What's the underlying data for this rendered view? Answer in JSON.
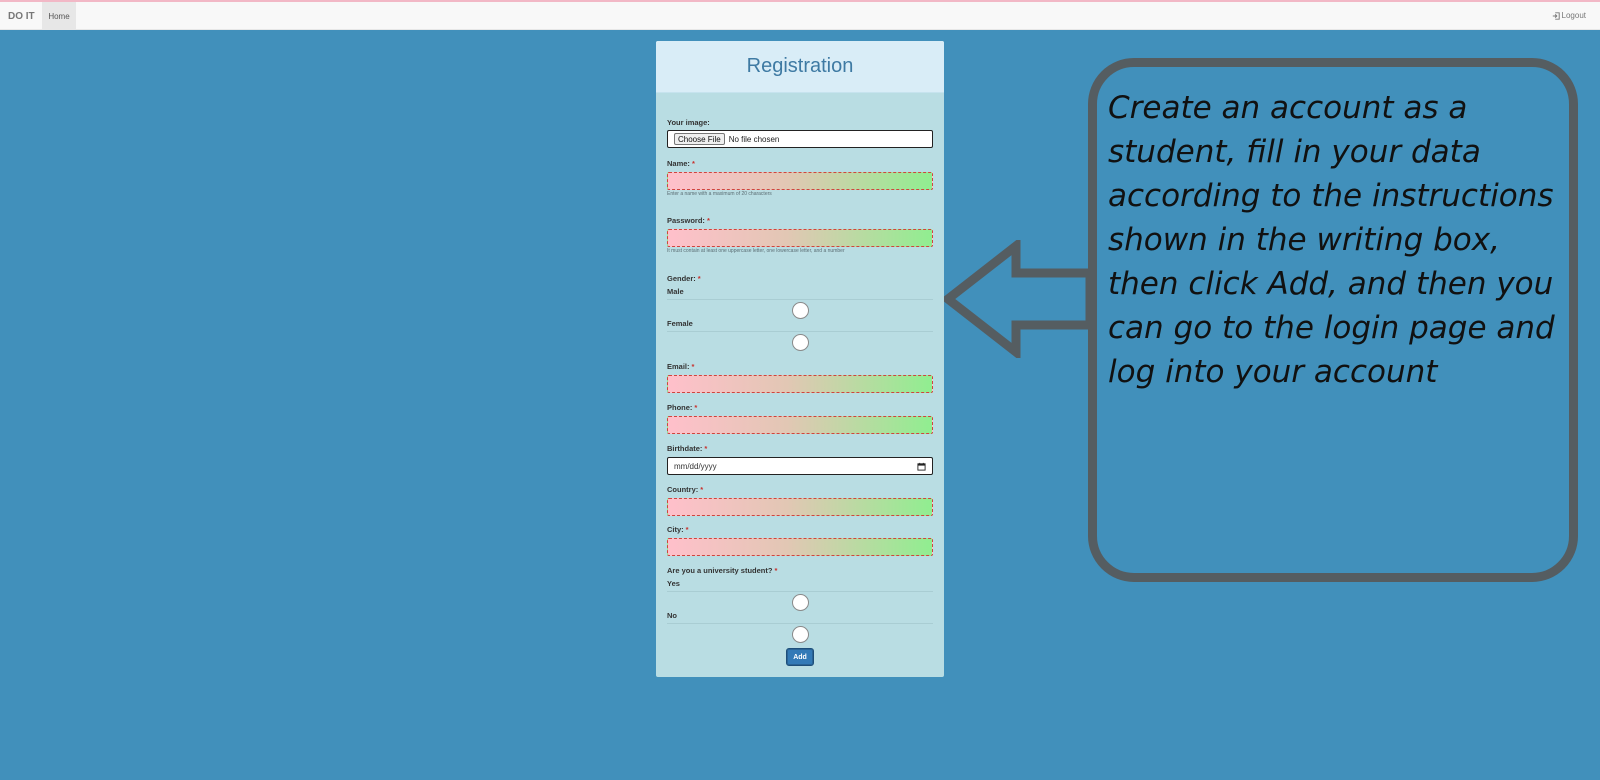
{
  "navbar": {
    "brand": "DO IT",
    "home": "Home",
    "logout": "Logout"
  },
  "panel": {
    "title": "Registration"
  },
  "form": {
    "image_label": "Your image:",
    "file_button": "Choose File",
    "file_status": "No file chosen",
    "name_label": "Name:",
    "name_hint": "Enter a name with a maximum of 20 characters",
    "password_label": "Password:",
    "password_hint": "It must contain at least one uppercase letter, one lowercase letter, and a number",
    "gender_label": "Gender:",
    "gender_options": [
      "Male",
      "Female"
    ],
    "email_label": "Email:",
    "phone_label": "Phone:",
    "birthdate_label": "Birthdate:",
    "birthdate_placeholder": "mm/dd/yyyy",
    "country_label": "Country:",
    "city_label": "City:",
    "student_label": "Are you a university student?",
    "student_options": [
      "Yes",
      "No"
    ],
    "required_mark": "*",
    "add_button": "Add"
  },
  "callout": {
    "text": "Create an account as a student, fill in your data according to the instructions shown in the writing box, then click Add, and then you can go to the login page and log into your account"
  },
  "colors": {
    "background": "#4190bb",
    "panel": "#b9dde3",
    "panel_heading": "#d9edf7",
    "title": "#3e7aa3",
    "button": "#337ab7",
    "callout_border": "#555d61"
  }
}
